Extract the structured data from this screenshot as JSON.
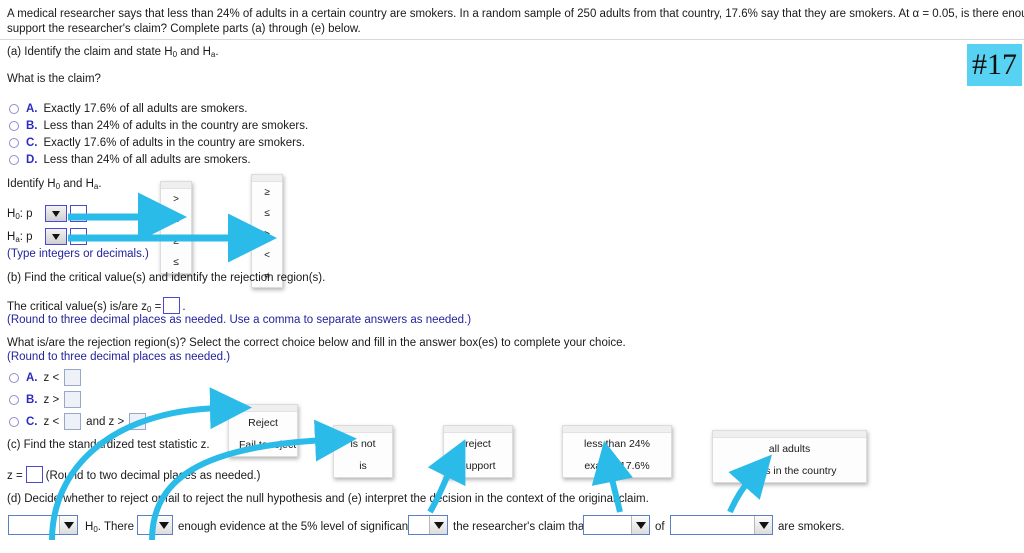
{
  "problem": {
    "line1": "A medical researcher says that less than 24% of adults in a certain country are smokers. In a random sample of 250 adults from that country, 17.6% say that they are smokers. At α = 0.05, is there enough evidence to",
    "line2": "support the researcher's claim? Complete parts (a) through (e) below."
  },
  "badge": {
    "label": "#17",
    "color": "#57d2f2"
  },
  "parts": {
    "a_heading": "(a) Identify the claim and state H₀ and Hₐ.",
    "a_question": "What is the claim?",
    "a_choices": [
      {
        "letter": "A.",
        "text": "Exactly 17.6% of all adults are smokers."
      },
      {
        "letter": "B.",
        "text": "Less than 24% of adults in the country are smokers."
      },
      {
        "letter": "C.",
        "text": "Exactly 17.6% of adults in the country are smokers."
      },
      {
        "letter": "D.",
        "text": "Less than 24% of all adults are smokers."
      }
    ],
    "identify_label": "Identify H₀ and Hₐ.",
    "h0_prefix": "H₀: p",
    "ha_prefix": "Hₐ: p",
    "type_note": "(Type integers or decimals.)",
    "b_heading": "(b) Find the critical value(s) and identify the rejection region(s).",
    "critical_prefix": "The critical value(s) is/are z₀ =",
    "critical_suffix": ".",
    "round_three_comma": "(Round to three decimal places as needed. Use a comma to separate answers as needed.)",
    "rejection_question": "What is/are the rejection region(s)? Select the correct choice below and fill in the answer box(es) to complete your choice.",
    "round_three": "(Round to three decimal places as needed.)",
    "rejection_choices": [
      {
        "letter": "A.",
        "pre": "z <",
        "mid": "",
        "post": ""
      },
      {
        "letter": "B.",
        "pre": "z >",
        "mid": "",
        "post": ""
      },
      {
        "letter": "C.",
        "pre": "z <",
        "mid": "and z >",
        "post": ""
      }
    ],
    "c_heading": "(c) Find the standardized test statistic z.",
    "z_prefix": "z =",
    "round_two": "(Round to two decimal places as needed.)",
    "de_heading": "(d) Decide whether to reject or fail to reject the null hypothesis and (e) interpret the decision in the context of the original claim."
  },
  "popups": {
    "h0_operators": [
      ">",
      "<",
      "≥",
      "≤"
    ],
    "ha_operators": [
      "≥",
      "≤",
      ">",
      "<",
      "≠"
    ],
    "decision": [
      "Reject",
      "Fail to reject"
    ],
    "is_not": [
      "is not",
      "is"
    ],
    "reject_support": [
      "reject",
      "support"
    ],
    "claim_value": [
      "less than 24%",
      "exactly 17.6%"
    ],
    "population": [
      "all adults",
      "adults in the country"
    ]
  },
  "final_sentence": {
    "seg1": "H₀. There",
    "seg2": "enough evidence at the 5% level of significance to",
    "seg3": "the researcher's claim that",
    "seg4": "of",
    "seg5": "are smokers."
  },
  "colors": {
    "arrow": "#2bbbe8",
    "link_blue": "#2b2bbf",
    "box_border": "#4a4ad0"
  }
}
